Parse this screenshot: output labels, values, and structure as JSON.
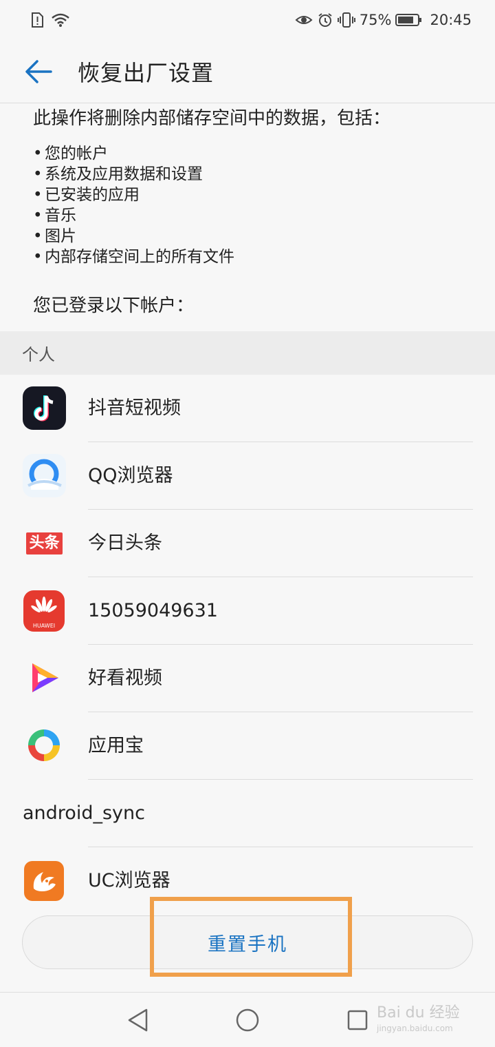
{
  "status_bar": {
    "battery_percent": "75%",
    "time": "20:45",
    "icons": [
      "sim-alert-icon",
      "wifi-icon",
      "eye-comfort-icon",
      "alarm-icon",
      "vibrate-icon",
      "battery-icon"
    ]
  },
  "app_bar": {
    "title": "恢复出厂设置"
  },
  "content": {
    "intro": "此操作将删除内部储存空间中的数据，包括：",
    "bullet_marker": "•",
    "bullets": [
      "您的帐户",
      "系统及应用数据和设置",
      "已安装的应用",
      "音乐",
      "图片",
      "内部存储空间上的所有文件"
    ],
    "logged_in_label": "您已登录以下帐户："
  },
  "section": {
    "personal_label": "个人"
  },
  "accounts": [
    {
      "label": "抖音短视频",
      "icon": "douyin-icon"
    },
    {
      "label": "QQ浏览器",
      "icon": "qq-browser-icon"
    },
    {
      "label": "今日头条",
      "icon": "toutiao-icon",
      "icon_text": "头条"
    },
    {
      "label": "15059049631",
      "icon": "huawei-icon",
      "icon_text": "HUAWEI"
    },
    {
      "label": "好看视频",
      "icon": "haokan-icon"
    },
    {
      "label": "应用宝",
      "icon": "yingyongbao-icon"
    },
    {
      "label": "android_sync",
      "icon": null
    },
    {
      "label": "UC浏览器",
      "icon": "uc-browser-icon"
    }
  ],
  "reset_button": {
    "label": "重置手机"
  },
  "watermark": {
    "text": "Bai du 经验",
    "url": "jingyan.baidu.com"
  },
  "colors": {
    "accent": "#1a73c2",
    "highlight": "#f0a04b",
    "toutiao_red": "#e8413e",
    "huawei_red": "#e53a2f",
    "uc_orange": "#f07a22"
  }
}
